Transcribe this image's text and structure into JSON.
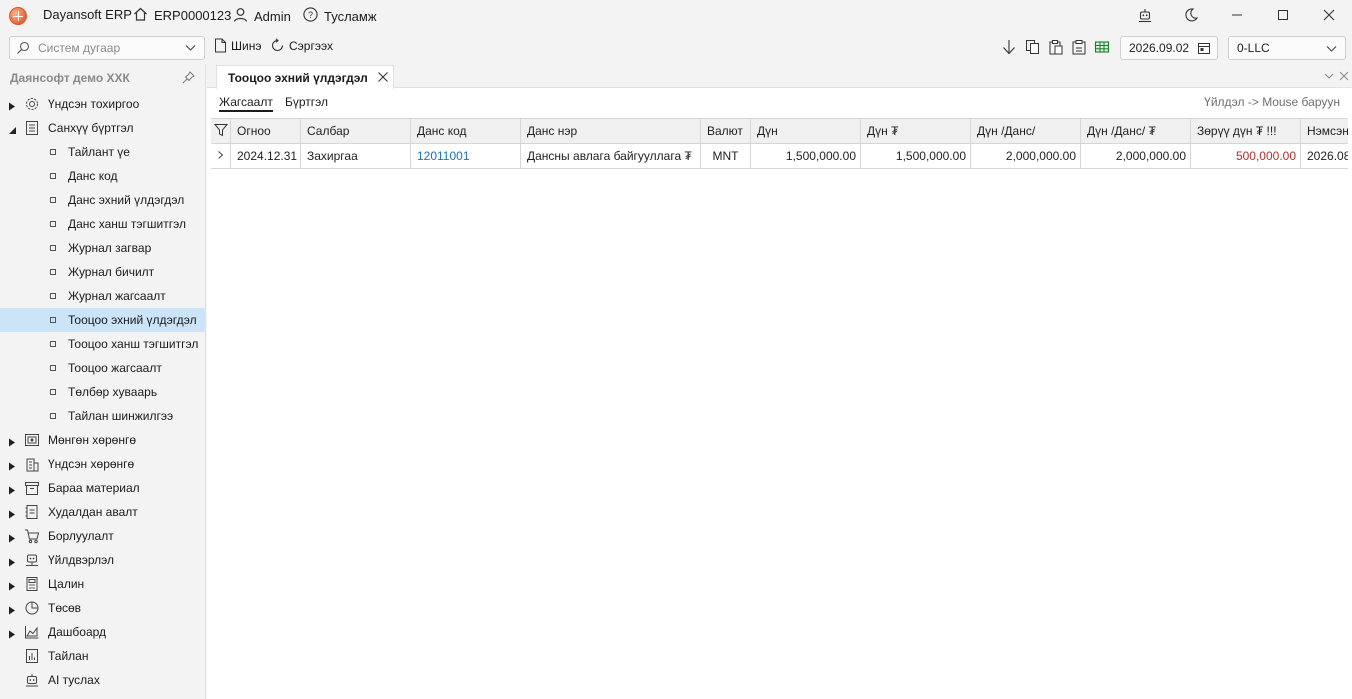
{
  "titlebar": {
    "app_name": "Dayansoft ERP",
    "system_code": "ERP0000123",
    "user": "Admin",
    "help": "Тусламж"
  },
  "toolbar": {
    "search_placeholder": "Систем дугаар",
    "new_label": "Шинэ",
    "refresh_label": "Сэргээх",
    "date": "2026.09.02",
    "company": "0-LLC"
  },
  "sidebar": {
    "company_name": "Даянсофт демо ХХК",
    "items": [
      {
        "label": "Үндсэн тохиргоо",
        "icon": "gear-icon",
        "expanded": false
      },
      {
        "label": "Санхүү бүртгэл",
        "icon": "ledger-icon",
        "expanded": true
      },
      {
        "label": "Мөнгөн хөрөнгө",
        "icon": "cash-icon",
        "expanded": false
      },
      {
        "label": "Үндсэн хөрөнгө",
        "icon": "building-icon",
        "expanded": false
      },
      {
        "label": "Бараа материал",
        "icon": "inventory-icon",
        "expanded": false
      },
      {
        "label": "Худалдан авалт",
        "icon": "purchase-icon",
        "expanded": false
      },
      {
        "label": "Борлуулалт",
        "icon": "cart-icon",
        "expanded": false
      },
      {
        "label": "Үйлдвэрлэл",
        "icon": "factory-icon",
        "expanded": false
      },
      {
        "label": "Цалин",
        "icon": "calculator-icon",
        "expanded": false
      },
      {
        "label": "Төсөв",
        "icon": "pie-chart-icon",
        "expanded": false
      },
      {
        "label": "Дашбоард",
        "icon": "area-chart-icon",
        "expanded": false
      },
      {
        "label": "Тайлан",
        "icon": "report-icon"
      },
      {
        "label": "AI туслах",
        "icon": "robot-icon"
      }
    ],
    "finance_children": [
      "Тайлант үе",
      "Данс код",
      "Данс эхний үлдэгдэл",
      "Данс ханш тэгшитгэл",
      "Журнал загвар",
      "Журнал бичилт",
      "Журнал жагсаалт",
      "Тооцоо эхний үлдэгдэл",
      "Тооцоо ханш тэгшитгэл",
      "Тооцоо жагсаалт",
      "Төлбөр хуваарь",
      "Тайлан шинжилгээ"
    ],
    "active_child": "Тооцоо эхний үлдэгдэл"
  },
  "main": {
    "tab_title": "Тооцоо эхний үлдэгдэл",
    "subtabs": [
      "Жагсаалт",
      "Бүртгэл"
    ],
    "hint": "Үйлдэл -> Mouse баруун",
    "columns": [
      "Огноо",
      "Салбар",
      "Данс код",
      "Данс нэр",
      "Валют",
      "Дүн",
      "Дүн ₮",
      "Дүн /Данс/",
      "Дүн /Данс/ ₮",
      "Зөрүү дүн ₮ !!!",
      "Нэмсэн"
    ],
    "rows": [
      {
        "date": "2024.12.31",
        "branch": "Захиргаа",
        "account_code": "12011001",
        "account_name": "Дансны авлага байгууллага ₮",
        "currency": "MNT",
        "amount": "1,500,000.00",
        "amount_mnt": "1,500,000.00",
        "amount_account": "2,000,000.00",
        "amount_account_mnt": "2,000,000.00",
        "diff_mnt": "500,000.00",
        "added": "2026.08"
      }
    ]
  },
  "colors": {
    "active_bg": "#cce4f7",
    "link": "#1a73b8",
    "diff_red": "#b03030"
  }
}
